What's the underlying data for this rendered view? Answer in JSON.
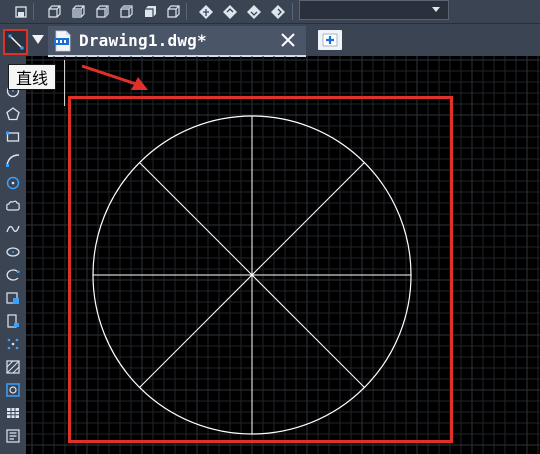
{
  "toolbar": {
    "icons": [
      "named-views-icon",
      "top-view-icon",
      "bottom-view-icon",
      "left-view-icon",
      "right-view-icon",
      "front-view-icon",
      "back-view-icon",
      "sw-iso-icon",
      "se-iso-icon",
      "ne-iso-icon",
      "nw-iso-icon"
    ],
    "view_dropdown_value": ""
  },
  "tabs": {
    "line_tool_icon": "line-tool-icon",
    "document_title": "Drawing1.dwg*",
    "close_icon": "close-icon",
    "new_tab_icon": "new-tab-icon"
  },
  "tooltip": {
    "text": "直线"
  },
  "left_toolbar": {
    "icons": [
      "circle-icon",
      "polygon-icon",
      "rectangle-icon",
      "arc-icon",
      "donut-icon",
      "revcloud-icon",
      "spline-icon",
      "ellipse-icon",
      "ellipse-arc-icon",
      "insert-block-icon",
      "create-block-icon",
      "point-icon",
      "hatch-icon",
      "region-icon",
      "table-icon",
      "multiline-text-icon"
    ]
  },
  "colors": {
    "ui_bg": "#3b4453",
    "canvas_bg": "#000000",
    "highlight": "#e0302a",
    "drawing_lines": "#ffffff"
  }
}
